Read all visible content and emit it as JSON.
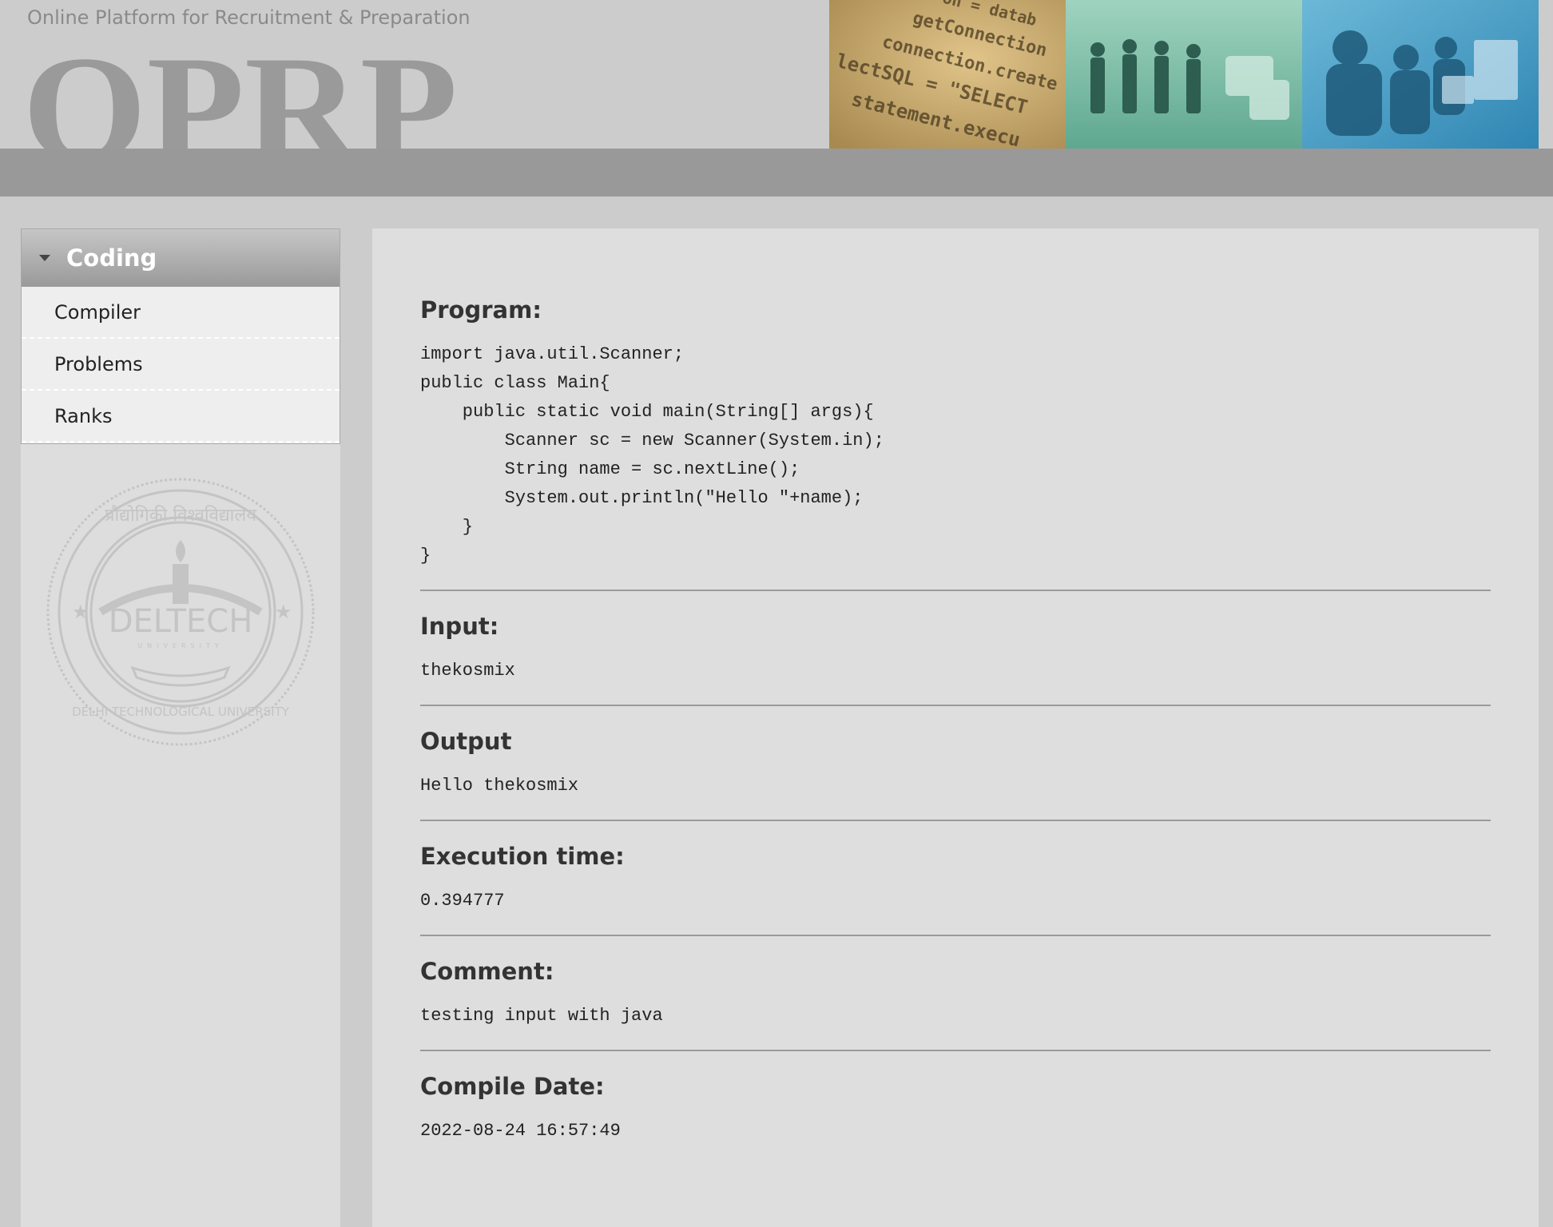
{
  "header": {
    "tagline": "Online Platform for Recruitment & Preparation",
    "logo_text": "OPRP",
    "banner_code_lines": [
      "on = datab",
      "getConnection",
      "connection.create",
      "lectSQL = \"SELECT",
      "statement.execu"
    ]
  },
  "sidebar": {
    "menu_title": "Coding",
    "items": [
      {
        "label": "Compiler"
      },
      {
        "label": "Problems"
      },
      {
        "label": "Ranks"
      }
    ],
    "seal": {
      "hindi_text": "प्रौद्योगिकी विश्वविद्यालय",
      "center_text": "DELTECH",
      "sub_text": "UNIVERSITY",
      "ring_text": "DELHI TECHNOLOGICAL UNIVERSITY"
    }
  },
  "result": {
    "program_label": "Program:",
    "program_code": "import java.util.Scanner;\npublic class Main{\n    public static void main(String[] args){\n        Scanner sc = new Scanner(System.in);\n        String name = sc.nextLine();\n        System.out.println(\"Hello \"+name);\n    }\n}",
    "input_label": "Input:",
    "input_value": "thekosmix",
    "output_label": "Output",
    "output_value": "Hello thekosmix",
    "exec_label": "Execution time:",
    "exec_value": "0.394777",
    "comment_label": "Comment:",
    "comment_value": "testing input with java",
    "date_label": "Compile Date:",
    "date_value": "2022-08-24 16:57:49"
  }
}
